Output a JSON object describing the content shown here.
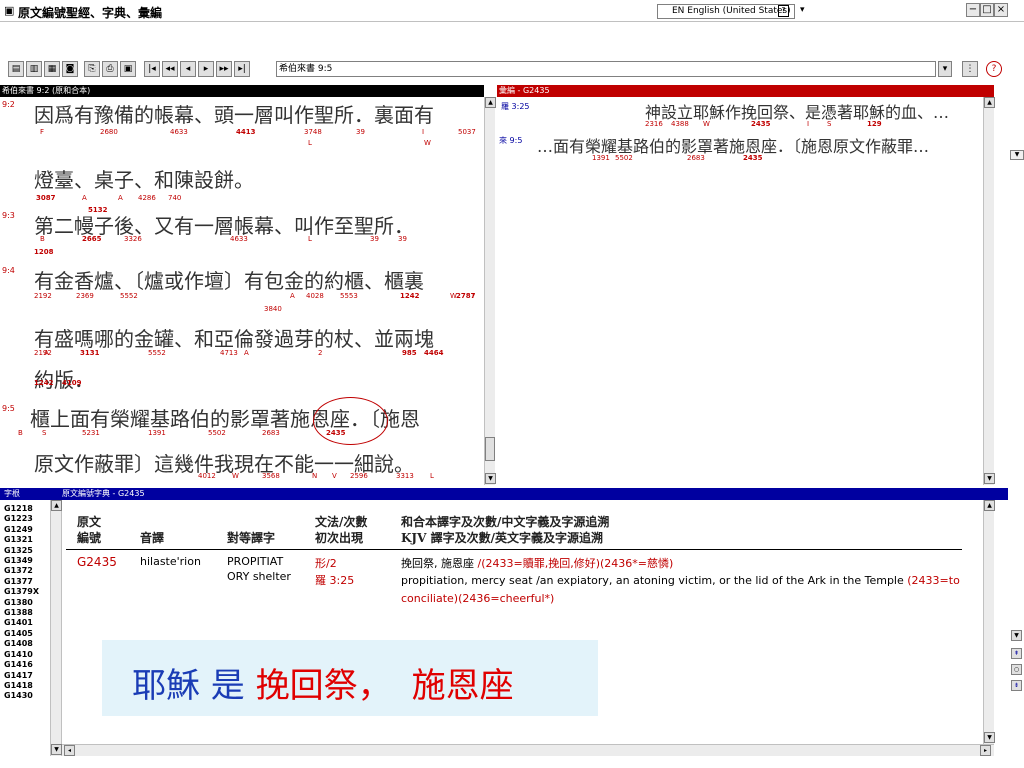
{
  "window": {
    "title": "原文編號聖經、字典、彙編",
    "language": "EN English (United States)",
    "help": "?"
  },
  "nav": {
    "current_ref": "希伯來書 9:5"
  },
  "left_pane": {
    "header": "希伯來書 9:2 (原和合本)",
    "lines": [
      {
        "verse": "9:2",
        "text": "因爲有豫備的帳幕、頭一層叫作聖所．裏面有",
        "strongs": [
          "F",
          "2680",
          "4633",
          "4413",
          "3748",
          "39",
          "I",
          "5037",
          "L",
          "W"
        ]
      },
      {
        "verse": "",
        "text": "燈臺、桌子、和陳設餅。",
        "strongs": [
          "3087",
          "A",
          "A",
          "4286",
          "740",
          "5132"
        ]
      },
      {
        "verse": "9:3",
        "text": "第二幔子後、又有一層帳幕、叫作至聖所．",
        "strongs": [
          "B",
          "2665",
          "3326",
          "4633",
          "L",
          "39",
          "39",
          "1208"
        ]
      },
      {
        "verse": "9:4",
        "text": "有金香爐、〔爐或作壇〕有包金的約櫃、櫃裏",
        "strongs": [
          "2192",
          "5552",
          "2369",
          "A",
          "4028",
          "5553",
          "1242",
          "2787",
          "W",
          "I",
          "3840"
        ]
      },
      {
        "verse": "",
        "text": "有盛嗎哪的金罐、和亞倫發過芽的杖、並兩塊",
        "strongs": [
          "2192",
          "3131",
          "5552",
          "4713",
          "A",
          "2",
          "985",
          "4464",
          "A"
        ]
      },
      {
        "verse": "",
        "text": "約版．",
        "strongs": [
          "1242",
          "4109"
        ]
      },
      {
        "verse": "9:5",
        "text": "櫃上面有榮耀基路伯的影罩著施恩座．〔施恩",
        "strongs": [
          "B",
          "S",
          "5231",
          "1391",
          "5502",
          "2683",
          "2435"
        ]
      },
      {
        "verse": "",
        "text": "原文作蔽罪〕這幾件我現在不能一一細說。",
        "strongs": [
          "4012",
          "W",
          "3568",
          "N",
          "V",
          "2596",
          "3313",
          "L"
        ]
      }
    ]
  },
  "right_pane": {
    "header": "彙編 - G2435",
    "refs": [
      {
        "ref": "羅 3:25",
        "text": "神設立耶穌作挽回祭、是憑著耶穌的血、…",
        "strongs": [
          "2316",
          "4388",
          "W",
          "2435",
          "I",
          "S",
          "129"
        ]
      },
      {
        "ref": "來 9:5",
        "text": "…面有榮耀基路伯的影罩著施恩座．〔施恩原文作蔽罪…",
        "strongs": [
          "1391",
          "5502",
          "2683",
          "2435"
        ]
      }
    ]
  },
  "bottom_pane": {
    "tab1": "字根",
    "tab2": "原文編號字典 - G2435",
    "glist": [
      "G1218",
      "G1223",
      "G1249",
      "G1321",
      "G1325",
      "G1349",
      "G1372",
      "G1377",
      "G1379X",
      "G1380",
      "G1388",
      "G1401",
      "G1405",
      "G1408",
      "G1410",
      "G1416",
      "G1417",
      "G1418",
      "G1430"
    ],
    "headers": {
      "col1_l1": "原文",
      "col1_l2": "編號",
      "col2": "音譯",
      "col3": "對等譯字",
      "col4_l1": "文法/次數",
      "col4_l2": "初次出現",
      "col5_l1": "和合本譯字及次數/中文字義及字源追溯",
      "col5_l2": "KJV 譯字及次數/英文字義及字源追溯"
    },
    "row": {
      "code": "G2435",
      "translit": "hilaste'rion",
      "equiv_l1": "PROPITIAT",
      "equiv_l2": "ORY shelter",
      "grammar_l1": "形/2",
      "grammar_l2": "羅 3:25",
      "cn_black": "挽回祭, 施恩座",
      "cn_red": " /(2433=贖罪,挽回,修好)(2436*=慈憐)",
      "en_black": "propitiation, mercy seat /an expiatory, an atoning victim, or the lid of the Ark in the Temple ",
      "en_red1": "(2433=to",
      "en_red2": "conciliate)(2436=cheerful*)"
    }
  },
  "banner": {
    "part1": "耶穌 是 ",
    "part2": "挽回祭，",
    "part3": "施恩座"
  },
  "colors": {
    "accent_red": "#c00000",
    "header_blue": "#0000a0",
    "banner_bg": "#e3f3fa"
  }
}
